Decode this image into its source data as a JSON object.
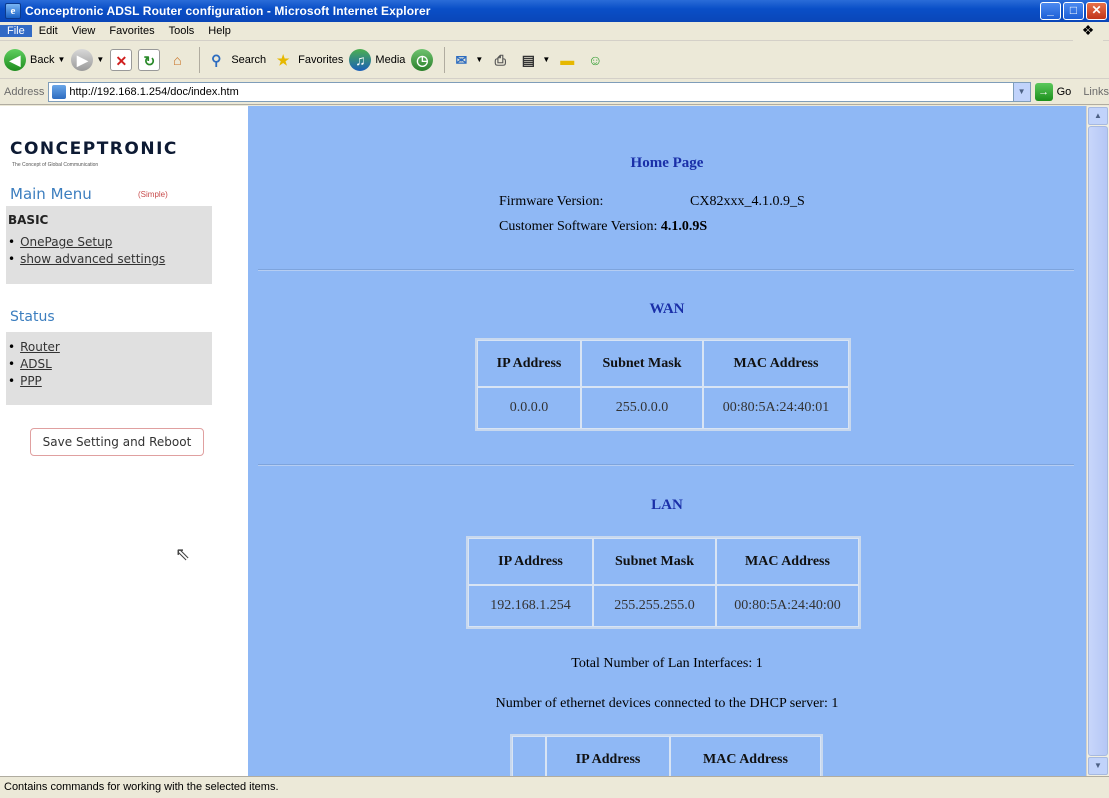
{
  "window": {
    "title": "Conceptronic ADSL Router configuration - Microsoft Internet Explorer",
    "minimize": "_",
    "maximize": "□",
    "close": "✕"
  },
  "menu": [
    "File",
    "Edit",
    "View",
    "Favorites",
    "Tools",
    "Help"
  ],
  "toolbar": {
    "back": "Back",
    "search": "Search",
    "favorites": "Favorites",
    "media": "Media"
  },
  "address": {
    "label": "Address",
    "url": "http://192.168.1.254/doc/index.htm",
    "go": "Go",
    "links": "Links"
  },
  "sidebar": {
    "logo": "CONCEPTRONIC",
    "tagline": "The Concept of Global Communication",
    "main_menu": "Main Menu",
    "simple": "(Simple)",
    "basic_heading": "BASIC",
    "basic_items": [
      "OnePage Setup",
      "show advanced settings"
    ],
    "status_heading": "Status",
    "status_items": [
      "Router",
      "ADSL",
      "PPP"
    ],
    "save_button": "Save Setting and Reboot"
  },
  "home": {
    "title": "Home Page",
    "fw_label": "Firmware Version:",
    "fw_value": "CX82xxx_4.1.0.9_S",
    "csw_label": "Customer Software Version:",
    "csw_value": "4.1.0.9S"
  },
  "wan": {
    "title": "WAN",
    "headers": [
      "IP Address",
      "Subnet Mask",
      "MAC Address"
    ],
    "row": [
      "0.0.0.0",
      "255.0.0.0",
      "00:80:5A:24:40:01"
    ]
  },
  "lan": {
    "title": "LAN",
    "headers": [
      "IP Address",
      "Subnet Mask",
      "MAC Address"
    ],
    "row": [
      "192.168.1.254",
      "255.255.255.0",
      "00:80:5A:24:40:00"
    ],
    "total_interfaces": "Total Number of Lan Interfaces: 1",
    "dhcp_devices": "Number of ethernet devices connected to the DHCP server: 1"
  },
  "dhcp_table": {
    "headers": [
      "",
      "IP Address",
      "MAC Address"
    ]
  },
  "statusbar": {
    "text": "Contains commands for working with the selected items."
  }
}
